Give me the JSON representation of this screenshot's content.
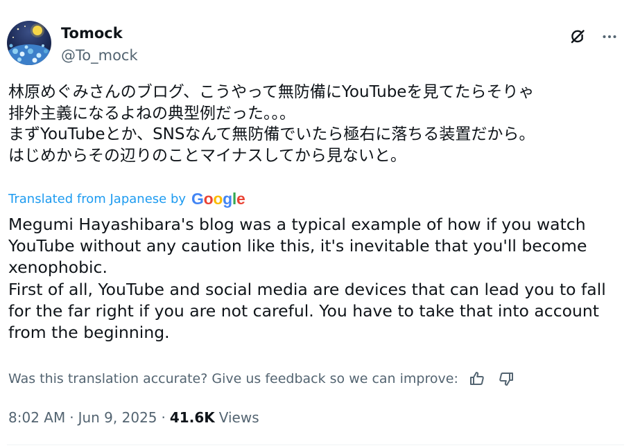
{
  "author": {
    "display_name": "Tomock",
    "handle": "@To_mock"
  },
  "header_icons": [
    "grok-icon",
    "more-icon"
  ],
  "tweet": {
    "original_lines": [
      "林原めぐみさんのブログ、こうやって無防備にYouTubeを見てたらそりゃ",
      "排外主義になるよねの典型例だった。。。",
      "まずYouTubeとか、SNSなんて無防備でいたら極右に落ちる装置だから。",
      "はじめからその辺りのことマイナスしてから見ないと。"
    ],
    "translated_by_label": "Translated from Japanese by",
    "translation_provider": "Google",
    "translation_lines": [
      "Megumi Hayashibara's blog was a typical example of how if you watch",
      "YouTube without any caution like this, it's inevitable that you'll become",
      "xenophobic.",
      "First of all, YouTube and social media are devices that can lead you to fall",
      "for the far right if you are not careful. You have to take that into account",
      "from the beginning."
    ],
    "feedback_prompt": "Was this translation accurate? Give us feedback so we can improve:",
    "time": "8:02 AM",
    "separator": "·",
    "date": "Jun 9, 2025",
    "views_count": "41.6K",
    "views_label": "Views"
  },
  "colors": {
    "text_primary": "#0f1419",
    "text_secondary": "#536471",
    "link": "#1d9bf0",
    "google_blue": "#4285F4",
    "google_red": "#EA4335",
    "google_yellow": "#FBBC05",
    "google_green": "#34A853"
  }
}
